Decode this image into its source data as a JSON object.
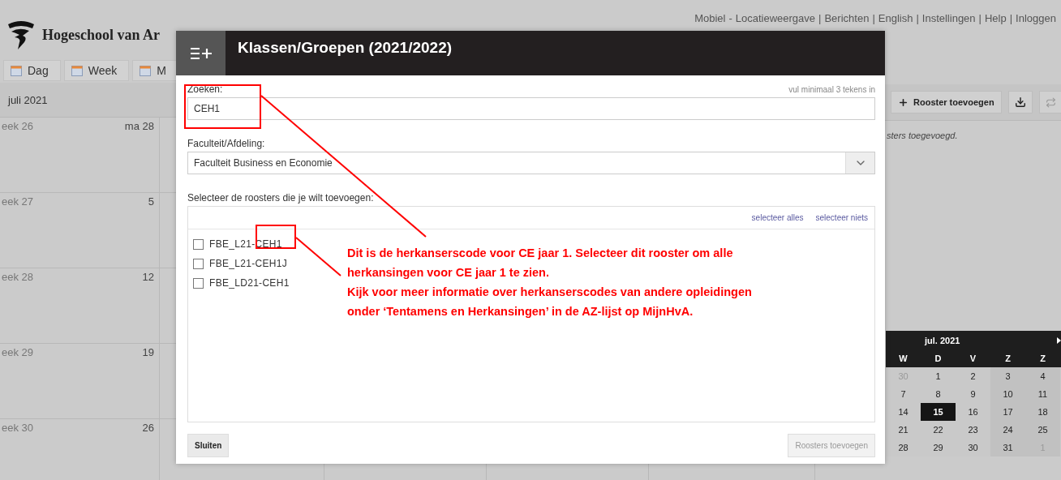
{
  "header": {
    "logo_text": "Hogeschool van Ar",
    "links": [
      {
        "label": "Mobiel"
      },
      {
        "separator": "-",
        "label": "Locatieweergave"
      },
      {
        "separator": "|",
        "label": "Berichten"
      },
      {
        "separator": "|",
        "label": "English"
      },
      {
        "separator": "|",
        "label": "Instellingen"
      },
      {
        "separator": "|",
        "label": "Help"
      },
      {
        "separator": "|",
        "label": "Inloggen"
      }
    ]
  },
  "view_tabs": [
    {
      "label": "Dag"
    },
    {
      "label": "Week"
    },
    {
      "label": "M"
    }
  ],
  "period": "juli 2021",
  "weeks": [
    {
      "week": "eek 26",
      "day": "ma 28"
    },
    {
      "week": "eek 27",
      "day": "5"
    },
    {
      "week": "eek 28",
      "day": "12"
    },
    {
      "week": "eek 29",
      "day": "19"
    },
    {
      "week": "eek 30",
      "day": "26"
    }
  ],
  "toolbar": {
    "add_button": "Rooster toevoegen",
    "sync_disabled": true
  },
  "schedule_note": "sters toegevoegd.",
  "mini_calendar": {
    "month": "jul. 2021",
    "weekdays": [
      "W",
      "D",
      "V",
      "Z",
      "Z"
    ],
    "weeks": [
      [
        {
          "label": "30",
          "muted": true,
          "selected": false
        },
        {
          "label": "1",
          "muted": false,
          "selected": false
        },
        {
          "label": "2",
          "muted": false,
          "selected": false
        },
        {
          "label": "3",
          "muted": false,
          "selected": false
        },
        {
          "label": "4",
          "muted": false,
          "selected": false
        }
      ],
      [
        {
          "label": "7",
          "muted": false,
          "selected": false
        },
        {
          "label": "8",
          "muted": false,
          "selected": false
        },
        {
          "label": "9",
          "muted": false,
          "selected": false
        },
        {
          "label": "10",
          "muted": false,
          "selected": false
        },
        {
          "label": "11",
          "muted": false,
          "selected": false
        }
      ],
      [
        {
          "label": "14",
          "muted": false,
          "selected": false
        },
        {
          "label": "15",
          "muted": false,
          "selected": true
        },
        {
          "label": "16",
          "muted": false,
          "selected": false
        },
        {
          "label": "17",
          "muted": false,
          "selected": false
        },
        {
          "label": "18",
          "muted": false,
          "selected": false
        }
      ],
      [
        {
          "label": "21",
          "muted": false,
          "selected": false
        },
        {
          "label": "22",
          "muted": false,
          "selected": false
        },
        {
          "label": "23",
          "muted": false,
          "selected": false
        },
        {
          "label": "24",
          "muted": false,
          "selected": false
        },
        {
          "label": "25",
          "muted": false,
          "selected": false
        }
      ],
      [
        {
          "label": "28",
          "muted": false,
          "selected": false
        },
        {
          "label": "29",
          "muted": false,
          "selected": false
        },
        {
          "label": "30",
          "muted": false,
          "selected": false
        },
        {
          "label": "31",
          "muted": false,
          "selected": false
        },
        {
          "label": "1",
          "muted": true,
          "selected": false
        }
      ]
    ]
  },
  "dialog": {
    "title": "Klassen/Groepen (2021/2022)",
    "search_label": "Zoeken:",
    "search_hint": "vul minimaal 3 tekens in",
    "search_value": "CEH1",
    "faculty_label": "Faculteit/Afdeling:",
    "faculty_value": "Faculteit Business en Economie",
    "list_label": "Selecteer de roosters die je wilt toevoegen:",
    "select_all": "selecteer alles",
    "select_none": "selecteer niets",
    "schedules": [
      {
        "label": "FBE_L21-CEH1",
        "checked": false
      },
      {
        "label": "FBE_L21-CEH1J",
        "checked": false
      },
      {
        "label": "FBE_LD21-CEH1",
        "checked": false
      }
    ],
    "close_button": "Sluiten",
    "add_button": {
      "label": "Roosters toevoegen",
      "disabled": true
    }
  },
  "annotation": {
    "text": "Dit is de herkanserscode voor CE jaar 1. Selecteer dit rooster om alle\nherkansingen voor CE jaar 1 te zien.\nKijk voor meer informatie over herkanserscodes van andere opleidingen\nonder ‘Tentamens en Herkansingen’ in de AZ-lijst op MijnHvA."
  }
}
